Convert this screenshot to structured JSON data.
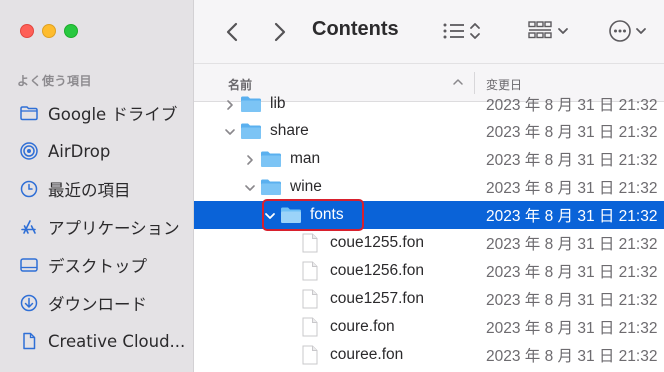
{
  "window": {
    "title": "Contents"
  },
  "sidebar": {
    "section_title": "よく使う項目",
    "items": [
      {
        "label": "Google ドライブ",
        "icon": "folder-icon"
      },
      {
        "label": "AirDrop",
        "icon": "airdrop-icon"
      },
      {
        "label": "最近の項目",
        "icon": "clock-icon"
      },
      {
        "label": "アプリケーション",
        "icon": "applications-icon"
      },
      {
        "label": "デスクトップ",
        "icon": "desktop-icon"
      },
      {
        "label": "ダウンロード",
        "icon": "download-icon"
      },
      {
        "label": "Creative Cloud...",
        "icon": "document-icon"
      }
    ]
  },
  "columns": {
    "name": "名前",
    "date": "変更日"
  },
  "rows": [
    {
      "name": "lib",
      "date": "2023 年 8 月 31 日 21:32",
      "kind": "folder",
      "level": 1,
      "expanded": false
    },
    {
      "name": "share",
      "date": "2023 年 8 月 31 日 21:32",
      "kind": "folder",
      "level": 0,
      "expanded": true
    },
    {
      "name": "man",
      "date": "2023 年 8 月 31 日 21:32",
      "kind": "folder",
      "level": 1,
      "expanded": false
    },
    {
      "name": "wine",
      "date": "2023 年 8 月 31 日 21:32",
      "kind": "folder",
      "level": 1,
      "expanded": true
    },
    {
      "name": "fonts",
      "date": "2023 年 8 月 31 日 21:32",
      "kind": "folder",
      "level": 2,
      "expanded": true,
      "selected": true
    },
    {
      "name": "coue1255.fon",
      "date": "2023 年 8 月 31 日 21:32",
      "kind": "file",
      "level": 3
    },
    {
      "name": "coue1256.fon",
      "date": "2023 年 8 月 31 日 21:32",
      "kind": "file",
      "level": 3
    },
    {
      "name": "coue1257.fon",
      "date": "2023 年 8 月 31 日 21:32",
      "kind": "file",
      "level": 3
    },
    {
      "name": "coure.fon",
      "date": "2023 年 8 月 31 日 21:32",
      "kind": "file",
      "level": 3
    },
    {
      "name": "couree.fon",
      "date": "2023 年 8 月 31 日 21:32",
      "kind": "file",
      "level": 3
    }
  ],
  "colors": {
    "selection": "#0a63d8",
    "highlight": "#d8202d",
    "folder": "#5ab0ef"
  }
}
